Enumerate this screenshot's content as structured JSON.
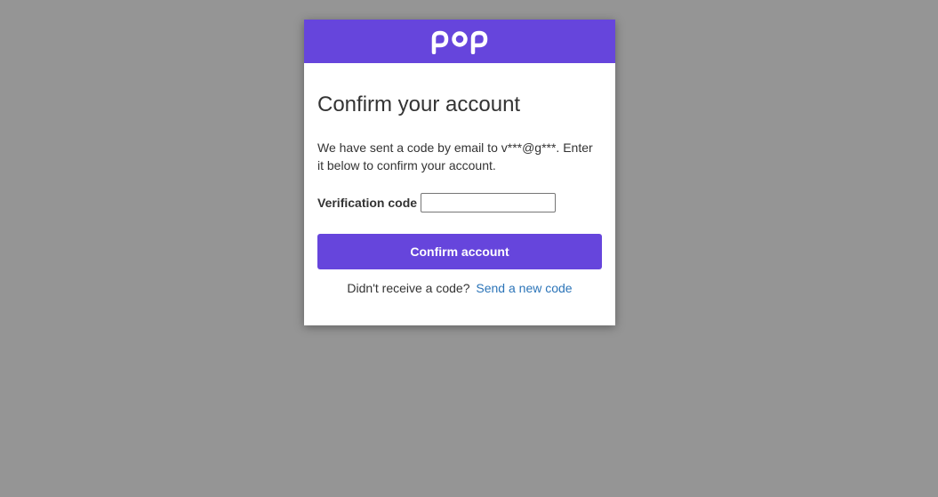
{
  "header": {
    "logo_name": "pop-logo",
    "brand_color": "#6645dc"
  },
  "main": {
    "title": "Confirm your account",
    "description": "We have sent a code by email to v***@g***. Enter it below to confirm your account.",
    "verification_label": "Verification code",
    "verification_value": "",
    "confirm_button_label": "Confirm account",
    "resend_prompt": "Didn't receive a code?",
    "resend_link_label": "Send a new code",
    "link_color": "#2b74b8"
  }
}
